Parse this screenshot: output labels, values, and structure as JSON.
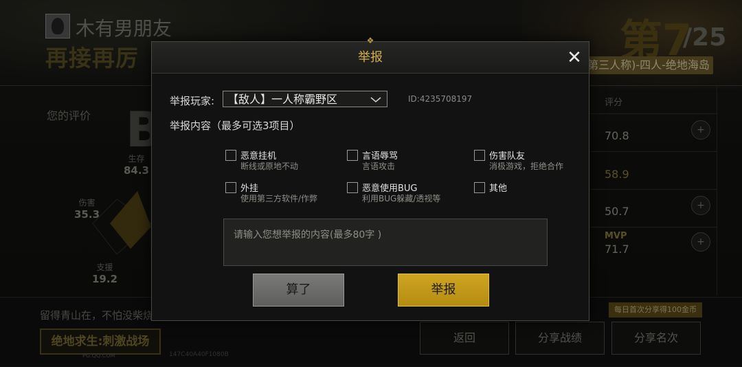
{
  "background": {
    "player_name": "木有男朋友",
    "slogan": "再接再厉",
    "rank": "第7",
    "rank_total": "/25",
    "mode": "第三人称)-四人-绝地海岛",
    "evaluation_label": "您的评价",
    "grade": "B",
    "stats": [
      {
        "label": "生存",
        "value": "84.3"
      },
      {
        "label": "伤害",
        "value": "35.3"
      },
      {
        "label": "支援",
        "value": "19.2"
      }
    ],
    "score_header": "评分",
    "scores": [
      {
        "value": "70.8",
        "badge": ""
      },
      {
        "value": "58.9",
        "badge": ""
      },
      {
        "value": "50.7",
        "badge": ""
      },
      {
        "value": "71.7",
        "badge": "MVP"
      }
    ],
    "tagline": "留得青山在，不怕没柴烧",
    "logo": "绝地求生:刺激战场",
    "logo_sub": "PG.QQ.COM",
    "build_id": "147C40A40F1080B",
    "share_tip": "每日首次分享得100金币",
    "buttons": {
      "back": "返回",
      "share_record": "分享战绩",
      "share_card": "分享名次"
    }
  },
  "modal": {
    "title": "举报",
    "report_player_label": "举报玩家:",
    "selected_player": "【敌人】一人称霸野区",
    "player_id": "ID:4235708197",
    "content_label": "举报内容（最多可选3项目）",
    "options": [
      {
        "title": "恶意挂机",
        "desc": "断线或原地不动",
        "checked": false
      },
      {
        "title": "言语辱骂",
        "desc": "言语攻击",
        "checked": false
      },
      {
        "title": "伤害队友",
        "desc": "消极游戏，拒绝合作",
        "checked": false
      },
      {
        "title": "外挂",
        "desc": "使用第三方软件/作弊",
        "checked": false
      },
      {
        "title": "恶意使用BUG",
        "desc": "利用BUG躲藏/透视等",
        "checked": false
      },
      {
        "title": "其他",
        "desc": "",
        "checked": false
      }
    ],
    "textarea_placeholder": "请输入您想举报的内容(最多80字 )",
    "cancel_label": "算了",
    "report_label": "举报"
  },
  "colors": {
    "accent": "#c9a020",
    "title": "#d4b04a"
  }
}
